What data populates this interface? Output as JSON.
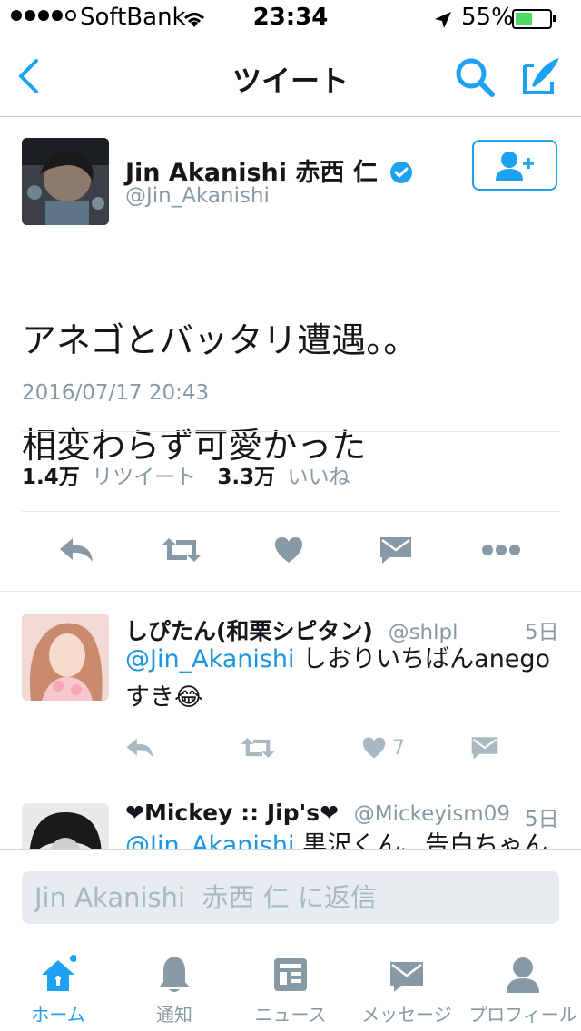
{
  "status_bar": {
    "carrier": "SoftBank",
    "time": "23:34",
    "battery_percent": "55%",
    "battery_level": 0.55
  },
  "nav": {
    "title": "ツイート"
  },
  "tweet": {
    "display_name": "Jin Akanishi  赤西 仁",
    "handle": "@Jin_Akanishi",
    "text_line1": "アネゴとバッタリ遭遇。。",
    "text_line2": "相変わらず可愛かった",
    "date": "2016/07/17 20:43",
    "retweet_count": "1.4万",
    "retweet_label": "リツイート",
    "like_count": "3.3万",
    "like_label": "いいね"
  },
  "replies": [
    {
      "name": "しぴたん(和栗シピタン)",
      "handle": "@shlpl",
      "time": "5日",
      "mention": "@Jin_Akanishi",
      "text": " しおりいちばんanego",
      "text2": "すき😂",
      "like_count": "7"
    },
    {
      "name": "❤Mickey :: Jip's❤",
      "handle": "@Mickeyism09",
      "time": "5日",
      "mention": "@Jin_Akanishi",
      "text": " 黒沢くん、告白ちゃん"
    }
  ],
  "reply_box": {
    "placeholder": "Jin Akanishi  赤西 仁 に返信"
  },
  "tabs": [
    {
      "label": "ホーム",
      "icon": "home-icon",
      "active": true
    },
    {
      "label": "通知",
      "icon": "bell-icon",
      "active": false
    },
    {
      "label": "ニュース",
      "icon": "news-icon",
      "active": false
    },
    {
      "label": "メッセージ",
      "icon": "envelope-icon",
      "active": false
    },
    {
      "label": "プロフィール",
      "icon": "person-icon",
      "active": false
    }
  ],
  "colors": {
    "accent": "#1da1f2",
    "secondary_text": "#8899a6",
    "icon_gray": "#8899a6"
  }
}
